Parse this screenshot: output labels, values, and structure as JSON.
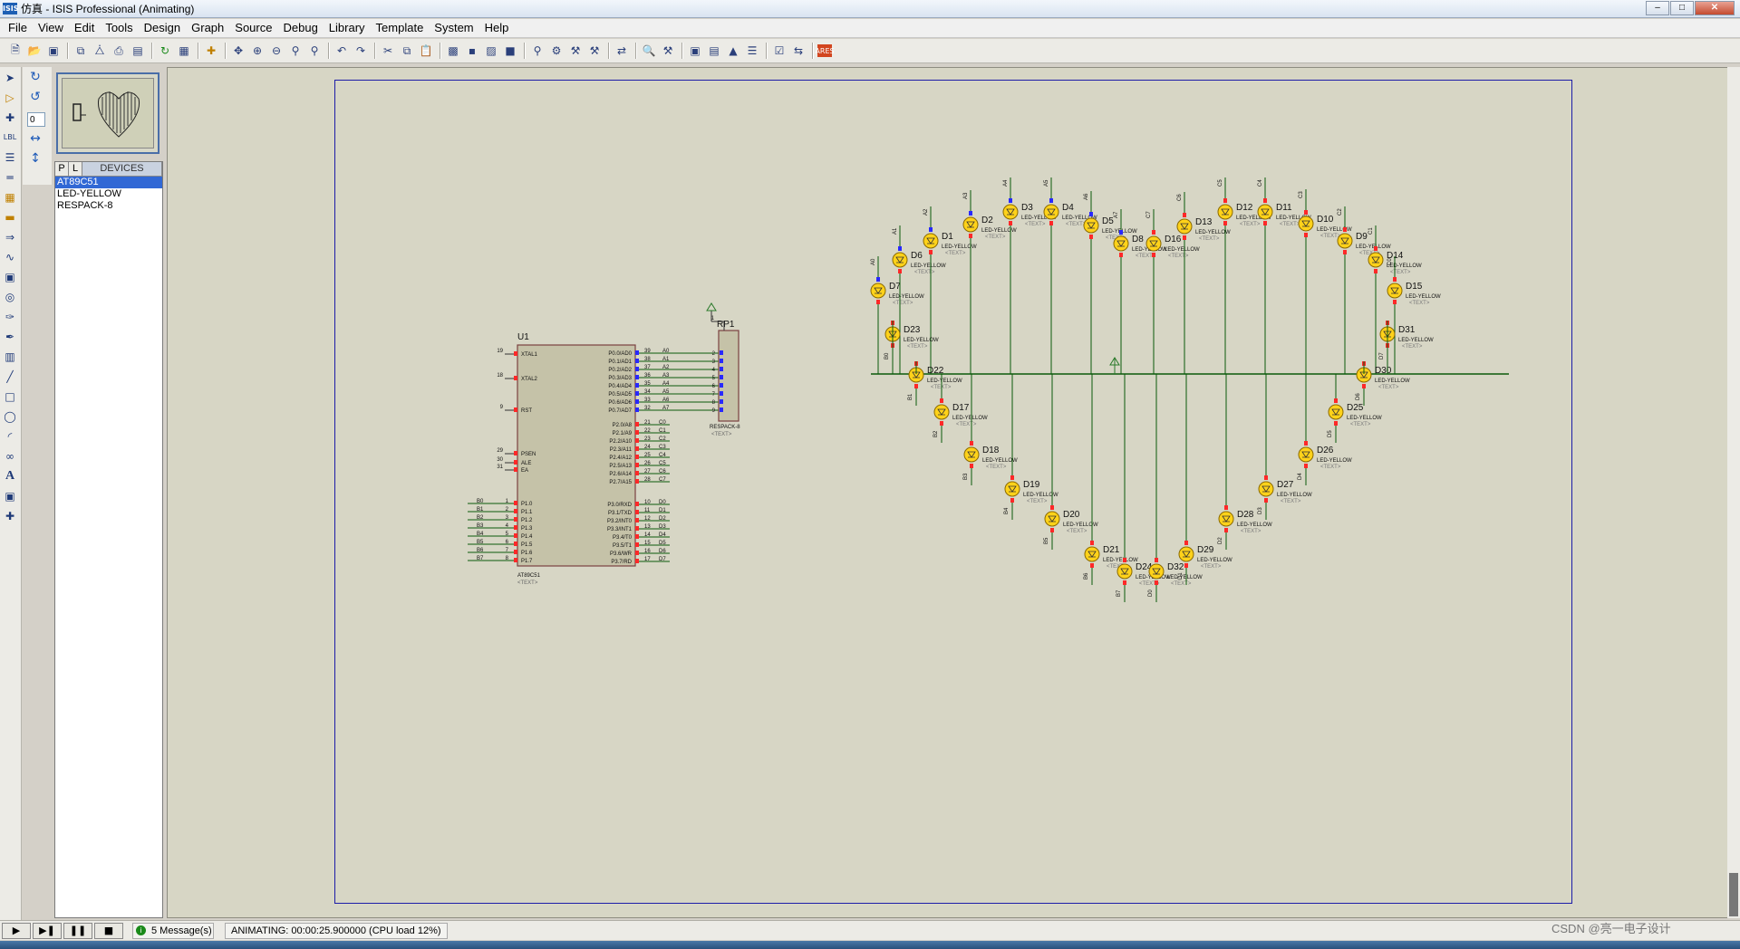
{
  "window": {
    "title": "仿真 - ISIS Professional (Animating)",
    "app_icon": "ISIS"
  },
  "menu": [
    "File",
    "View",
    "Edit",
    "Tools",
    "Design",
    "Graph",
    "Source",
    "Debug",
    "Library",
    "Template",
    "System",
    "Help"
  ],
  "rotation_value": "0",
  "device_panel": {
    "tab_p": "P",
    "tab_l": "L",
    "header": "DEVICES",
    "items": [
      "AT89C51",
      "LED-YELLOW",
      "RESPACK-8"
    ]
  },
  "schematic": {
    "mcu": {
      "ref": "U1",
      "part": "AT89C51",
      "text": "<TEXT>",
      "left_pins": [
        {
          "num": "19",
          "name": "XTAL1"
        },
        {
          "num": "18",
          "name": "XTAL2"
        },
        {
          "num": "9",
          "name": "RST"
        },
        {
          "num": "29",
          "name": "PSEN"
        },
        {
          "num": "30",
          "name": "ALE"
        },
        {
          "num": "31",
          "name": "EA"
        }
      ],
      "p1_pins": [
        {
          "num": "1",
          "name": "P1.0",
          "net": "B0"
        },
        {
          "num": "2",
          "name": "P1.1",
          "net": "B1"
        },
        {
          "num": "3",
          "name": "P1.2",
          "net": "B2"
        },
        {
          "num": "4",
          "name": "P1.3",
          "net": "B3"
        },
        {
          "num": "5",
          "name": "P1.4",
          "net": "B4"
        },
        {
          "num": "6",
          "name": "P1.5",
          "net": "B5"
        },
        {
          "num": "7",
          "name": "P1.6",
          "net": "B6"
        },
        {
          "num": "8",
          "name": "P1.7",
          "net": "B7"
        }
      ],
      "p0_pins": [
        {
          "num": "39",
          "name": "P0.0/AD0",
          "net": "A0"
        },
        {
          "num": "38",
          "name": "P0.1/AD1",
          "net": "A1"
        },
        {
          "num": "37",
          "name": "P0.2/AD2",
          "net": "A2"
        },
        {
          "num": "36",
          "name": "P0.3/AD3",
          "net": "A3"
        },
        {
          "num": "35",
          "name": "P0.4/AD4",
          "net": "A4"
        },
        {
          "num": "34",
          "name": "P0.5/AD5",
          "net": "A5"
        },
        {
          "num": "33",
          "name": "P0.6/AD6",
          "net": "A6"
        },
        {
          "num": "32",
          "name": "P0.7/AD7",
          "net": "A7"
        }
      ],
      "p2_pins": [
        {
          "num": "21",
          "name": "P2.0/A8",
          "net": "C0"
        },
        {
          "num": "22",
          "name": "P2.1/A9",
          "net": "C1"
        },
        {
          "num": "23",
          "name": "P2.2/A10",
          "net": "C2"
        },
        {
          "num": "24",
          "name": "P2.3/A11",
          "net": "C3"
        },
        {
          "num": "25",
          "name": "P2.4/A12",
          "net": "C4"
        },
        {
          "num": "26",
          "name": "P2.5/A13",
          "net": "C5"
        },
        {
          "num": "27",
          "name": "P2.6/A14",
          "net": "C6"
        },
        {
          "num": "28",
          "name": "P2.7/A15",
          "net": "C7"
        }
      ],
      "p3_pins": [
        {
          "num": "10",
          "name": "P3.0/RXD",
          "net": "D0"
        },
        {
          "num": "11",
          "name": "P3.1/TXD",
          "net": "D1"
        },
        {
          "num": "12",
          "name": "P3.2/INT0",
          "net": "D2"
        },
        {
          "num": "13",
          "name": "P3.3/INT1",
          "net": "D3"
        },
        {
          "num": "14",
          "name": "P3.4/T0",
          "net": "D4"
        },
        {
          "num": "15",
          "name": "P3.5/T1",
          "net": "D5"
        },
        {
          "num": "16",
          "name": "P3.6/WR",
          "net": "D6"
        },
        {
          "num": "17",
          "name": "P3.7/RD",
          "net": "D7"
        }
      ]
    },
    "respack": {
      "ref": "RP1",
      "part": "RESPACK-8",
      "text": "<TEXT>",
      "pins": [
        "2",
        "3",
        "4",
        "5",
        "6",
        "7",
        "8",
        "9"
      ],
      "common": "1"
    },
    "led_part": "LED-YELLOW",
    "led_text": "<TEXT>",
    "leds": [
      {
        "ref": "D7",
        "net": "A0"
      },
      {
        "ref": "D6",
        "net": "A1"
      },
      {
        "ref": "D1",
        "net": "A2"
      },
      {
        "ref": "D2",
        "net": "A3"
      },
      {
        "ref": "D3",
        "net": "A4"
      },
      {
        "ref": "D4",
        "net": "A5"
      },
      {
        "ref": "D5",
        "net": "A6"
      },
      {
        "ref": "D8",
        "net": "A7"
      },
      {
        "ref": "D16",
        "net": "C7"
      },
      {
        "ref": "D13",
        "net": "C6"
      },
      {
        "ref": "D12",
        "net": "C5"
      },
      {
        "ref": "D11",
        "net": "C4"
      },
      {
        "ref": "D10",
        "net": "C3"
      },
      {
        "ref": "D9",
        "net": "C2"
      },
      {
        "ref": "D14",
        "net": "C1"
      },
      {
        "ref": "D15",
        "net": "C0"
      },
      {
        "ref": "D23",
        "net": "B0"
      },
      {
        "ref": "D22",
        "net": "B1"
      },
      {
        "ref": "D17",
        "net": "B2"
      },
      {
        "ref": "D18",
        "net": "B3"
      },
      {
        "ref": "D19",
        "net": "B4"
      },
      {
        "ref": "D20",
        "net": "B5"
      },
      {
        "ref": "D21",
        "net": "B6"
      },
      {
        "ref": "D24",
        "net": "B7"
      },
      {
        "ref": "D32",
        "net": "D0"
      },
      {
        "ref": "D29",
        "net": "D1"
      },
      {
        "ref": "D28",
        "net": "D2"
      },
      {
        "ref": "D27",
        "net": "D3"
      },
      {
        "ref": "D26",
        "net": "D4"
      },
      {
        "ref": "D25",
        "net": "D5"
      },
      {
        "ref": "D30",
        "net": "D6"
      },
      {
        "ref": "D31",
        "net": "D7"
      }
    ]
  },
  "status": {
    "messages": "5 Message(s)",
    "animating": "ANIMATING: 00:00:25.900000 (CPU load 12%)",
    "watermark": "CSDN @亮一电子设计"
  },
  "colors": {
    "wire": "#0b5a0b",
    "chip_fill": "#c5c2a8",
    "led_fill": "#ffd21a",
    "pin_active": "#ff2828",
    "pin_low": "#2828ff",
    "sheet_border": "#1c1ca8"
  }
}
